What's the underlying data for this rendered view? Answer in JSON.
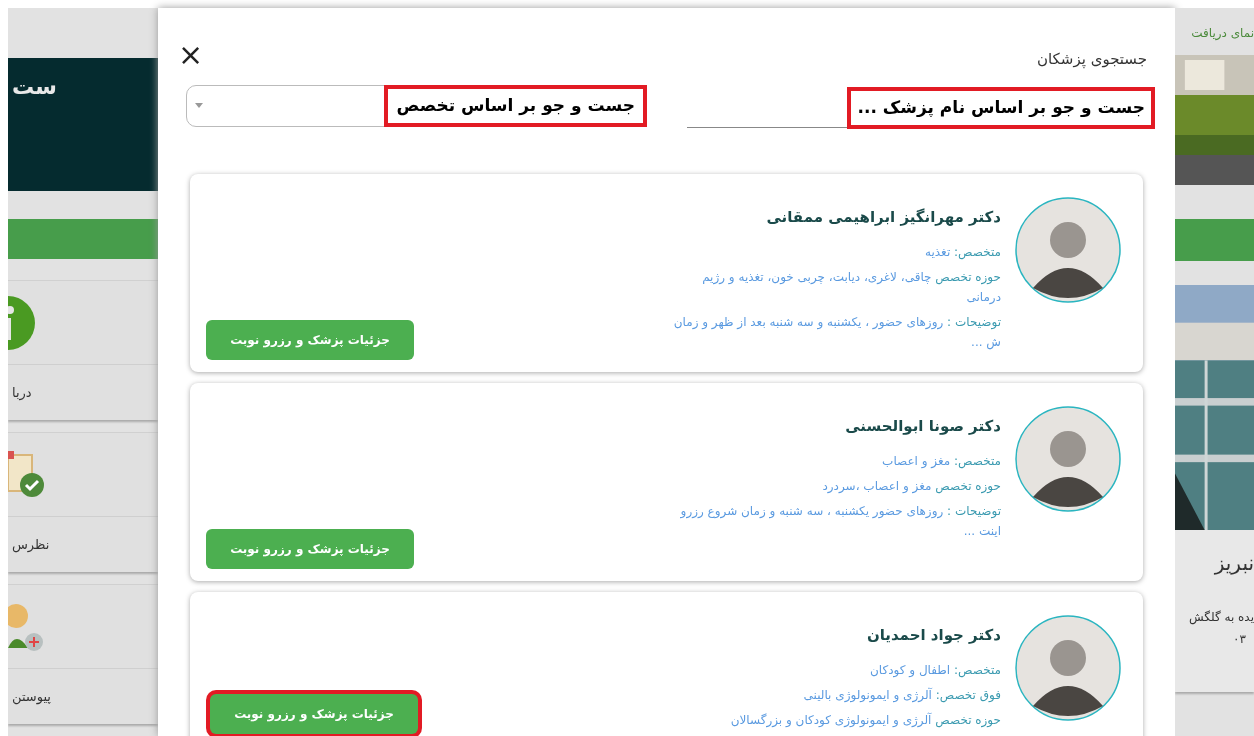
{
  "background": {
    "left": {
      "banner_text": "ست",
      "items": [
        {
          "kind": "info",
          "label": "دربا"
        },
        {
          "kind": "survey",
          "label": "نظرس"
        },
        {
          "kind": "join",
          "label": "پیوستن"
        }
      ]
    },
    "right": {
      "link_text": "نمای دریافت",
      "title": "نبریز",
      "text": "یده به گلگش",
      "number": "۰۳"
    }
  },
  "modal": {
    "title": "جستجوی پزشکان",
    "close": "×",
    "name_search": {
      "placeholder": "جست و جو بر اساس نام پزشک ...",
      "highlighted": true
    },
    "specialty_select": {
      "placeholder": "جست و جو بر اساس تخصص",
      "highlighted": true
    },
    "doctors": [
      {
        "name": "دکتر مهرانگیز ابراهیمی ممقانی",
        "lines": [
          {
            "label": "متخصص:",
            "value": "تغذیه"
          },
          {
            "label": "حوزه تخصص",
            "value": "چاقی، لاغری، دیابت، چربی خون، تغذیه و رژیم درمانی"
          },
          {
            "label": "توضیحات :",
            "value": "روزهای حضور ، یکشنبه و سه شنبه بعد از ظهر و زمان ش ..."
          }
        ],
        "button": "جزئیات پزشک و رزرو نوبت",
        "highlighted": false
      },
      {
        "name": "دکتر صونا ابوالحسنی",
        "lines": [
          {
            "label": "متخصص:",
            "value": "مغز و اعصاب"
          },
          {
            "label": "حوزه تخصص",
            "value": "مغز و اعصاب ،سردرد"
          },
          {
            "label": "توضیحات :",
            "value": "روزهای حضور یکشنبه ، سه شنبه و زمان شروع رزرو اینت ..."
          }
        ],
        "button": "جزئیات پزشک و رزرو نوبت",
        "highlighted": false
      },
      {
        "name": "دکتر جواد احمدیان",
        "lines": [
          {
            "label": "متخصص:",
            "value": "اطفال و کودکان"
          },
          {
            "label": "فوق تخصص:",
            "value": "آلرژی و ایمونولوژی بالینی"
          },
          {
            "label": "حوزه تخصص",
            "value": "آلرژی و ایمونولوژی کودکان و بزرگسالان"
          }
        ],
        "button": "جزئیات پزشک و رزرو نوبت",
        "highlighted": true
      }
    ]
  }
}
